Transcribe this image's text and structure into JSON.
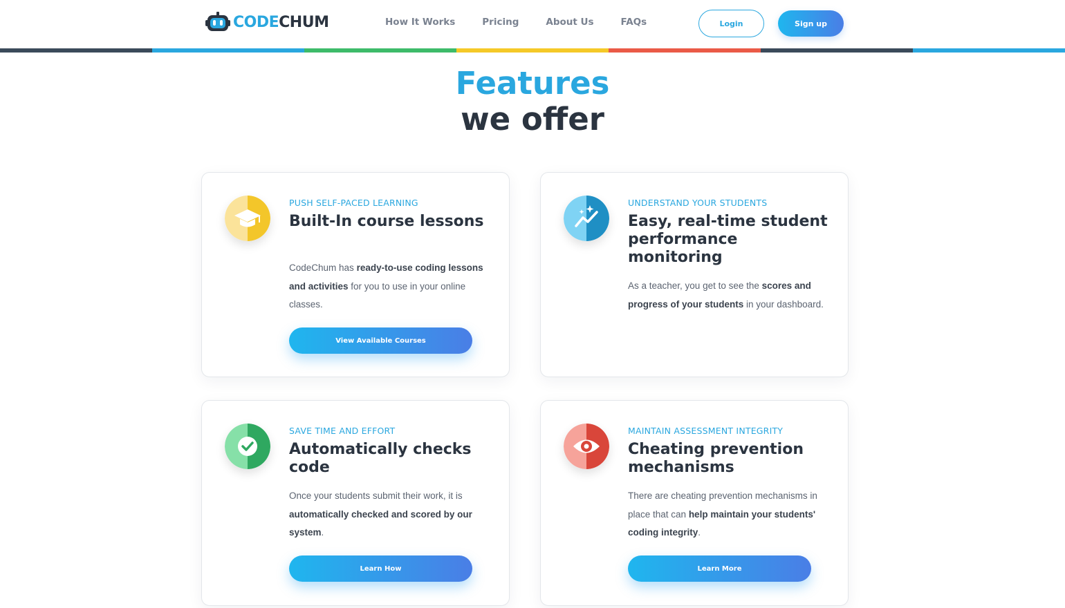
{
  "header": {
    "logo": {
      "part1": "CODE",
      "part2": "CHUM"
    },
    "nav": [
      "How It Works",
      "Pricing",
      "About Us",
      "FAQs"
    ],
    "login_label": "Login",
    "signup_label": "Sign up",
    "accent_colors": [
      "#3b4a5a",
      "#2aa7df",
      "#3ebb6a",
      "#f5c928",
      "#ea5a47",
      "#3b4a5a",
      "#2aa7df"
    ]
  },
  "hero": {
    "line1": "Features",
    "line2": "we offer"
  },
  "cards": [
    {
      "icon": "graduation-cap-icon",
      "icon_color": "#f5c928",
      "eyebrow": "PUSH SELF-PACED LEARNING",
      "heading": "Built-In course lessons",
      "desc": [
        {
          "t": "CodeChum has ",
          "b": false
        },
        {
          "t": "ready-to-use coding lessons and activities",
          "b": true
        },
        {
          "t": " for you to use in your online classes.",
          "b": false
        }
      ],
      "cta": "View Available Courses"
    },
    {
      "icon": "analytics-sparkle-icon",
      "icon_color": "#2aa7df",
      "eyebrow": "UNDERSTAND YOUR STUDENTS",
      "heading": "Easy, real-time student performance monitoring",
      "desc": [
        {
          "t": "As a teacher, you get to see the ",
          "b": false
        },
        {
          "t": "scores and progress of your students",
          "b": true
        },
        {
          "t": " in your dashboard.",
          "b": false
        }
      ],
      "cta": ""
    },
    {
      "icon": "checkmark-icon",
      "icon_color": "#3ebb6a",
      "eyebrow": "SAVE TIME AND EFFORT",
      "heading": "Automatically checks code",
      "desc": [
        {
          "t": "Once your students submit their work, it is ",
          "b": false
        },
        {
          "t": "automatically checked and scored by our system",
          "b": true
        },
        {
          "t": ".",
          "b": false
        }
      ],
      "cta": "Learn How"
    },
    {
      "icon": "eye-icon",
      "icon_color": "#ea5a47",
      "eyebrow": "MAINTAIN ASSESSMENT INTEGRITY",
      "heading": "Cheating prevention mechanisms",
      "desc": [
        {
          "t": "There are cheating prevention mechanisms in place that can ",
          "b": false
        },
        {
          "t": "help maintain your students' coding integrity",
          "b": true
        },
        {
          "t": ".",
          "b": false
        }
      ],
      "cta": "Learn More"
    }
  ]
}
